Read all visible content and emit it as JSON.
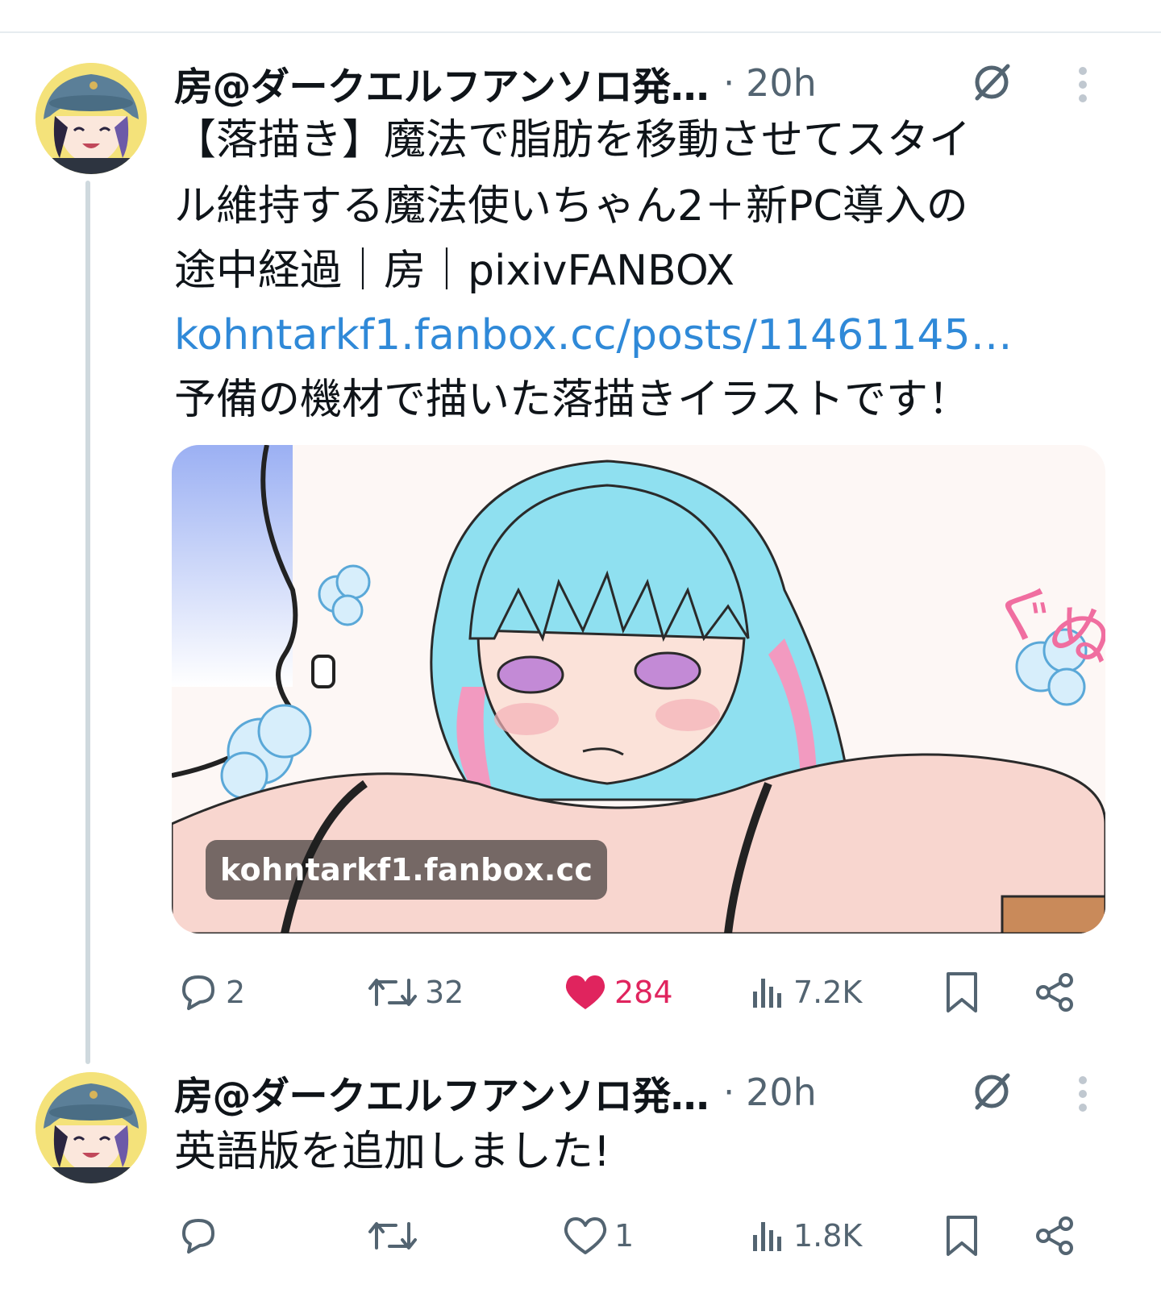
{
  "tweets": [
    {
      "author": "房@ダークエルフアンソロ発…",
      "separator": "·",
      "time": "20h",
      "text_lines": [
        "【落描き】魔法で脂肪を移動させてスタイ",
        "ル維持する魔法使いちゃん2＋新PC導入の",
        "途中経過｜房｜pixivFANBOX"
      ],
      "link": "kohntarkf1.fanbox.cc/posts/11461145…",
      "text_after": "予備の機材で描いた落描きイラストです！",
      "media": {
        "domain_label": "kohntarkf1.fanbox.cc",
        "sfx_text": "ぐぬぬ…"
      },
      "actions": {
        "reply": "2",
        "retweet": "32",
        "like": "284",
        "views": "7.2K"
      },
      "liked": true
    },
    {
      "author": "房@ダークエルフアンソロ発…",
      "separator": "·",
      "time": "20h",
      "text": "英語版を追加しました!",
      "actions": {
        "reply": "",
        "retweet": "",
        "like": "1",
        "views": "1.8K"
      },
      "liked": false
    }
  ],
  "colors": {
    "accent_link": "#2f89d8",
    "like_active": "#e0245e",
    "muted": "#536471",
    "thread_line": "#cfd9de"
  },
  "icons": [
    "reply-icon",
    "retweet-icon",
    "like-icon",
    "views-icon",
    "bookmark-icon",
    "share-icon",
    "grok-icon",
    "more-icon"
  ]
}
